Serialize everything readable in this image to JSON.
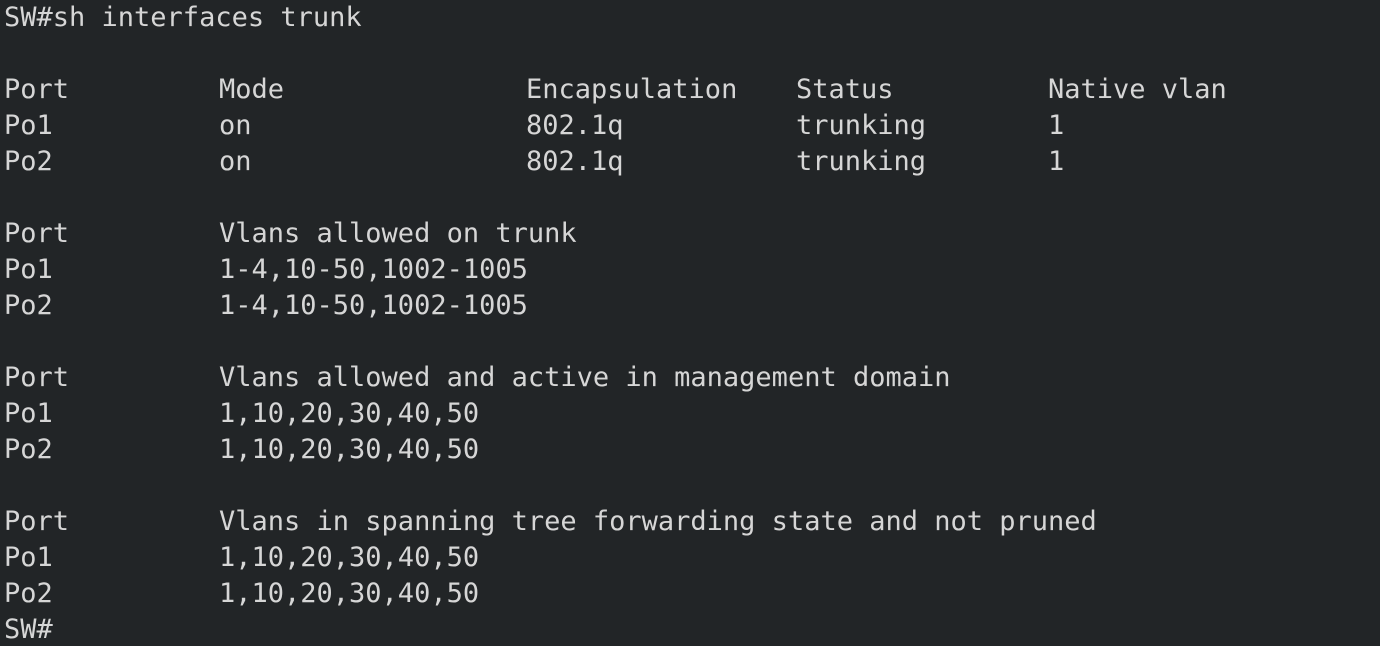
{
  "command": {
    "prompt_line": "SW#sh interfaces trunk",
    "end_prompt": "SW#"
  },
  "trunk_status": {
    "headers": [
      "Port",
      "Mode",
      "Encapsulation",
      "Status",
      "Native vlan"
    ],
    "rows": [
      [
        "Po1",
        "on",
        "802.1q",
        "trunking",
        "1"
      ],
      [
        "Po2",
        "on",
        "802.1q",
        "trunking",
        "1"
      ]
    ]
  },
  "vlans_allowed": {
    "headers": [
      "Port",
      "Vlans allowed on trunk"
    ],
    "rows": [
      [
        "Po1",
        "1-4,10-50,1002-1005"
      ],
      [
        "Po2",
        "1-4,10-50,1002-1005"
      ]
    ]
  },
  "vlans_active": {
    "headers": [
      "Port",
      "Vlans allowed and active in management domain"
    ],
    "rows": [
      [
        "Po1",
        "1,10,20,30,40,50"
      ],
      [
        "Po2",
        "1,10,20,30,40,50"
      ]
    ]
  },
  "vlans_forwarding": {
    "headers": [
      "Port",
      "Vlans in spanning tree forwarding state and not pruned"
    ],
    "rows": [
      [
        "Po1",
        "1,10,20,30,40,50"
      ],
      [
        "Po2",
        "1,10,20,30,40,50"
      ]
    ]
  },
  "colors": {
    "background": "#222527",
    "text": "#d6d6d6"
  }
}
